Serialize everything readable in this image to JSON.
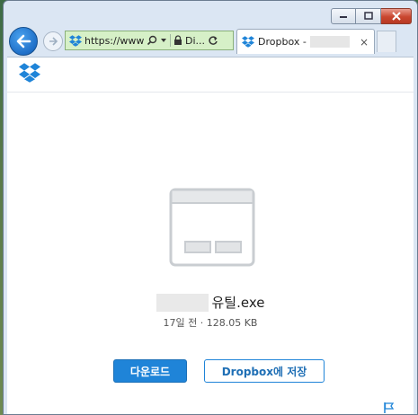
{
  "browser": {
    "address_text": "https://www.d",
    "address_site": "Di...",
    "tab_title": "Dropbox -",
    "tab_close": "×",
    "icons": [
      "back-arrow-icon",
      "forward-arrow-icon",
      "dropbox-favicon",
      "search-icon",
      "dropdown-icon",
      "lock-icon",
      "refresh-icon",
      "close-icon",
      "minimize-icon",
      "maximize-icon"
    ]
  },
  "file": {
    "name": "유틸.exe",
    "meta": "17일 전 · 128.05 KB"
  },
  "actions": {
    "download_label": "다운로드",
    "save_label": "Dropbox에 저장"
  },
  "colors": {
    "accent": "#1f84d8",
    "address_bar_secure": "#d6f0c7",
    "close_button": "#c9462f"
  }
}
